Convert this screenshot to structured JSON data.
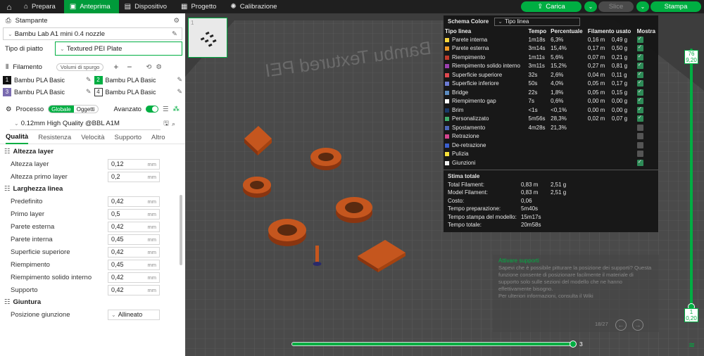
{
  "topbar": {
    "tabs": [
      {
        "label": "Prepara",
        "icon": "prepare-icon"
      },
      {
        "label": "Anteprima",
        "icon": "preview-icon",
        "active": true
      },
      {
        "label": "Dispositivo",
        "icon": "device-icon"
      },
      {
        "label": "Progetto",
        "icon": "project-icon"
      },
      {
        "label": "Calibrazione",
        "icon": "calibration-icon"
      }
    ],
    "slice_label": "Carica",
    "slice_disabled_label": "Slice",
    "print_label": "Stampa",
    "accent": "#00ae42"
  },
  "printer": {
    "section_title": "Stampante",
    "model": "Bambu Lab A1 mini 0.4 nozzle",
    "plate_label": "Tipo di piatto",
    "plate_value": "Textured PEI Plate"
  },
  "filament": {
    "section_title": "Filamento",
    "purge_button": "Volumi di spurgo",
    "slots": [
      {
        "num": "1",
        "name": "Bambu PLA Basic",
        "color": "#111111"
      },
      {
        "num": "2",
        "name": "Bambu PLA Basic",
        "color": "#00ae42"
      },
      {
        "num": "3",
        "name": "Bambu PLA Basic",
        "color": "#7a6bb0"
      },
      {
        "num": "4",
        "name": "Bambu PLA Basic",
        "color": "#ffffff"
      }
    ]
  },
  "process": {
    "section_title": "Processo",
    "seg_global": "Globale",
    "seg_objects": "Oggetti",
    "advanced_label": "Avanzato",
    "preset": "0.12mm High Quality @BBL A1M",
    "tabs": [
      "Qualità",
      "Resistenza",
      "Velocità",
      "Supporto",
      "Altro"
    ],
    "groups": [
      {
        "title": "Altezza layer",
        "rows": [
          {
            "label": "Altezza layer",
            "value": "0,12",
            "unit": "mm"
          },
          {
            "label": "Altezza primo layer",
            "value": "0,2",
            "unit": "mm"
          }
        ]
      },
      {
        "title": "Larghezza linea",
        "rows": [
          {
            "label": "Predefinito",
            "value": "0,42",
            "unit": "mm"
          },
          {
            "label": "Primo layer",
            "value": "0,5",
            "unit": "mm"
          },
          {
            "label": "Parete esterna",
            "value": "0,42",
            "unit": "mm"
          },
          {
            "label": "Parete interna",
            "value": "0,45",
            "unit": "mm"
          },
          {
            "label": "Superficie superiore",
            "value": "0,42",
            "unit": "mm"
          },
          {
            "label": "Riempimento",
            "value": "0,45",
            "unit": "mm"
          },
          {
            "label": "Riempimento solido interno",
            "value": "0,42",
            "unit": "mm"
          },
          {
            "label": "Supporto",
            "value": "0,42",
            "unit": "mm"
          }
        ]
      },
      {
        "title": "Giuntura",
        "rows": [
          {
            "label": "Posizione giunzione",
            "value": "Allineato",
            "unit": ""
          }
        ]
      }
    ]
  },
  "legend": {
    "title": "Schema Colore",
    "mode": "Tipo linea",
    "headers": [
      "Tipo linea",
      "Tempo",
      "Percentuale",
      "Filamento usato",
      "Mostra"
    ],
    "rows": [
      {
        "name": "Parete interna",
        "color": "#f7d63c",
        "time": "1m18s",
        "pct": "6,3%",
        "len": "0,16 m",
        "w": "0,49 g",
        "show": true
      },
      {
        "name": "Parete esterna",
        "color": "#f29b26",
        "time": "3m14s",
        "pct": "15,4%",
        "len": "0,17 m",
        "w": "0,50 g",
        "show": true
      },
      {
        "name": "Riempimento",
        "color": "#c0392b",
        "time": "1m11s",
        "pct": "5,6%",
        "len": "0,07 m",
        "w": "0,21 g",
        "show": true
      },
      {
        "name": "Riempimento solido interno",
        "color": "#9b3fb0",
        "time": "3m11s",
        "pct": "15,2%",
        "len": "0,27 m",
        "w": "0,81 g",
        "show": true
      },
      {
        "name": "Superficie superiore",
        "color": "#e0484f",
        "time": "32s",
        "pct": "2,6%",
        "len": "0,04 m",
        "w": "0,11 g",
        "show": true
      },
      {
        "name": "Superficie inferiore",
        "color": "#6c7bd4",
        "time": "50s",
        "pct": "4,0%",
        "len": "0,05 m",
        "w": "0,17 g",
        "show": true
      },
      {
        "name": "Bridge",
        "color": "#5b8bc0",
        "time": "22s",
        "pct": "1,8%",
        "len": "0,05 m",
        "w": "0,15 g",
        "show": true
      },
      {
        "name": "Riempimento gap",
        "color": "#ffffff",
        "time": "7s",
        "pct": "0,6%",
        "len": "0,00 m",
        "w": "0,00 g",
        "show": true
      },
      {
        "name": "Brim",
        "color": "#1a3a6a",
        "time": "<1s",
        "pct": "<0,1%",
        "len": "0,00 m",
        "w": "0,00 g",
        "show": true
      },
      {
        "name": "Personalizzato",
        "color": "#3fae6a",
        "time": "5m56s",
        "pct": "28,3%",
        "len": "0,02 m",
        "w": "0,07 g",
        "show": true
      },
      {
        "name": "Spostamento",
        "color": "#4c66b8",
        "time": "4m28s",
        "pct": "21,3%",
        "len": "",
        "w": "",
        "show": false
      },
      {
        "name": "Retrazione",
        "color": "#d6448f",
        "time": "",
        "pct": "",
        "len": "",
        "w": "",
        "show": false
      },
      {
        "name": "De-retrazione",
        "color": "#3a5fd0",
        "time": "",
        "pct": "",
        "len": "",
        "w": "",
        "show": false
      },
      {
        "name": "Pulizia",
        "color": "#f7e03a",
        "time": "",
        "pct": "",
        "len": "",
        "w": "",
        "show": false
      },
      {
        "name": "Giunzioni",
        "color": "#f0f0f0",
        "time": "",
        "pct": "",
        "len": "",
        "w": "",
        "show": true
      }
    ],
    "estimate_title": "Stima totale",
    "estimates": [
      {
        "k": "Total Filament:",
        "v": "0,83 m",
        "v2": "2,51 g"
      },
      {
        "k": "Model Filament:",
        "v": "0,83 m",
        "v2": "2,51 g"
      },
      {
        "k": "Costo:",
        "v": "0,06",
        "v2": ""
      },
      {
        "k": "Tempo preparazione:",
        "v": "5m40s",
        "v2": ""
      },
      {
        "k": "Tempo stampa del modello:",
        "v": "15m17s",
        "v2": ""
      },
      {
        "k": "Tempo totale:",
        "v": "20m58s",
        "v2": ""
      }
    ]
  },
  "tip": {
    "title": "Attivare supporti",
    "body": "Sapevi che è possibile pitturare la posizione dei supporti? Questa funzione consente di posizionare facilmente il materiale di supporto solo sulle sezioni del modello che ne hanno effettivamente bisogno.",
    "more": "Per ulteriori informazioni, consulta il Wiki",
    "page": "18/27"
  },
  "plate_text": "Bambu Textured PEI",
  "view": {
    "thumb_index": "1",
    "layer_slider_value": "3",
    "top_layer": "76",
    "top_height": "9,20",
    "bottom_layer": "1",
    "bottom_height": "0,20"
  }
}
